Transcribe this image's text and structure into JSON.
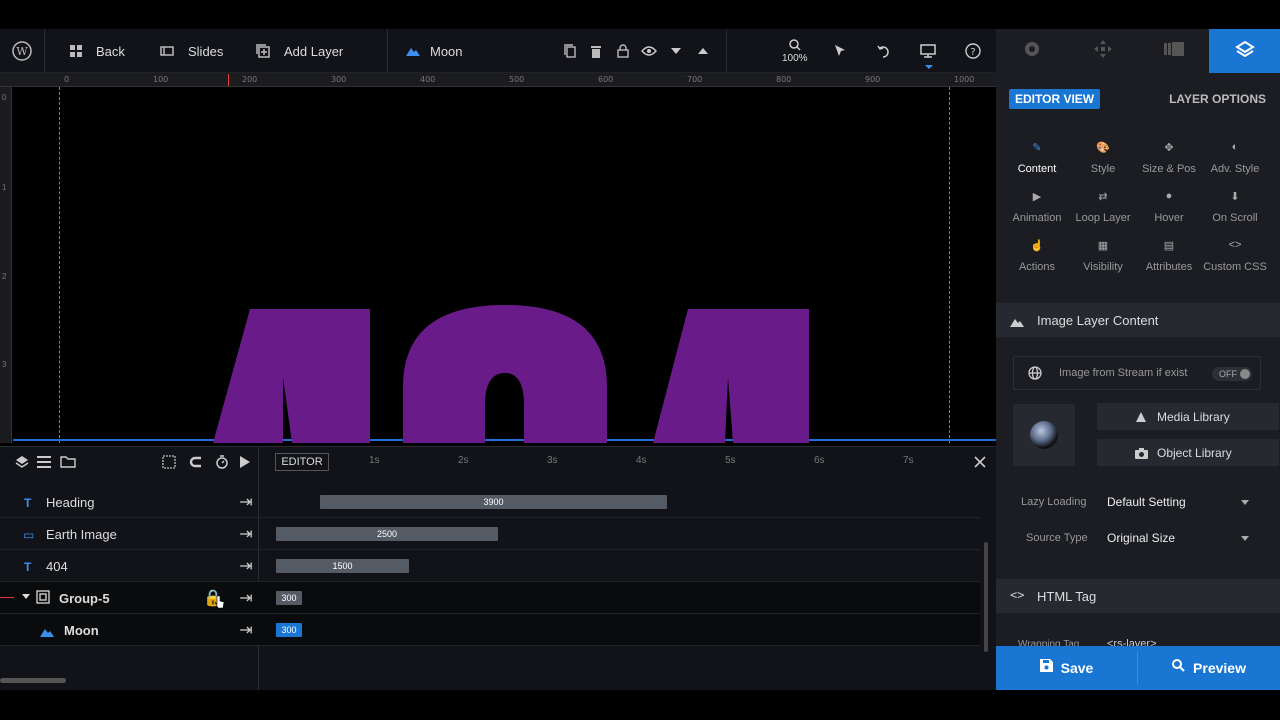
{
  "topbar": {
    "back": "Back",
    "slides": "Slides",
    "add_layer": "Add Layer",
    "layer_name": "Moon",
    "zoom": "100%"
  },
  "canvas": {
    "text": "404",
    "text_color": "#6a1b8a"
  },
  "ruler": {
    "ticks": [
      "0",
      "100",
      "200",
      "300",
      "400",
      "500",
      "600",
      "700",
      "800",
      "900",
      "1000"
    ]
  },
  "timeline": {
    "editor_label": "EDITOR",
    "seconds": [
      "1s",
      "2s",
      "3s",
      "4s",
      "5s",
      "6s",
      "7s"
    ],
    "layers": [
      {
        "name": "Heading",
        "duration": "3900"
      },
      {
        "name": "Earth Image",
        "duration": "2500"
      },
      {
        "name": "404",
        "duration": "1500"
      },
      {
        "name": "Group-5",
        "duration": "300"
      },
      {
        "name": "Moon",
        "duration": "300"
      }
    ]
  },
  "panel": {
    "editor_view": "EDITOR VIEW",
    "layer_options": "LAYER OPTIONS",
    "options": [
      "Content",
      "Style",
      "Size & Pos",
      "Adv. Style",
      "Animation",
      "Loop Layer",
      "Hover",
      "On Scroll",
      "Actions",
      "Visibility",
      "Attributes",
      "Custom CSS"
    ],
    "section_image": "Image Layer Content",
    "stream_label": "Image from Stream if exist",
    "stream_toggle": "OFF",
    "media_library": "Media Library",
    "object_library": "Object Library",
    "lazy_label": "Lazy Loading",
    "lazy_value": "Default Setting",
    "source_label": "Source Type",
    "source_value": "Original Size",
    "section_html": "HTML Tag",
    "wrapping_label": "Wrapping Tag",
    "wrapping_value": "<rs-layer>"
  },
  "actions": {
    "save": "Save",
    "preview": "Preview"
  },
  "colors": {
    "accent": "#1976d2",
    "timeline_blue": "#3b8ff0"
  }
}
